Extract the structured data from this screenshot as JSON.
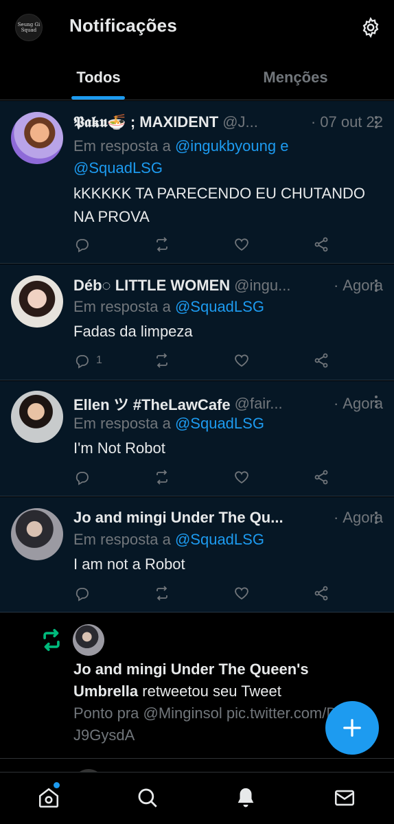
{
  "header": {
    "title": "Notificações",
    "logo_text": "Seung Gi Squad",
    "settings_icon": "gear-icon"
  },
  "tabs": [
    {
      "label": "Todos",
      "active": true
    },
    {
      "label": "Menções",
      "active": false
    }
  ],
  "notifications": [
    {
      "name": "𝕻𝖆𝖐𝖚🍜 ; MAXIDENT",
      "handle": "@J...",
      "time": "07 out 22",
      "reply_prefix": "Em resposta a",
      "reply_mentions": [
        "@ingukbyoung",
        "e",
        "@SquadLSG"
      ],
      "text": "kKKKKK TA PARECENDO EU CHUTANDO NA PROVA",
      "reply_count": ""
    },
    {
      "name": "Déb◌ LITTLE WOMEN",
      "handle": "@ingu...",
      "time": "Agora",
      "reply_prefix": "Em resposta a",
      "reply_mentions": [
        "@SquadLSG"
      ],
      "text": "Fadas da limpeza",
      "reply_count": "1"
    },
    {
      "name": "Ellen ツ #TheLawCafe",
      "handle": "@fair...",
      "time": "Agora",
      "reply_prefix": "Em resposta a",
      "reply_mentions": [
        "@SquadLSG"
      ],
      "text": "I'm Not Robot",
      "reply_count": ""
    },
    {
      "name": "Jo and mingi Under The Qu...",
      "handle": "",
      "time": "Agora",
      "reply_prefix": "Em resposta a",
      "reply_mentions": [
        "@SquadLSG"
      ],
      "text": "I am not a Robot",
      "reply_count": ""
    }
  ],
  "retweet": {
    "user": "Jo and mingi Under The Queen's Umbrella",
    "action": "retweetou seu Tweet",
    "tweet_text": "Ponto pra @Minginsol pic.twitter.com/DQAJ9GysdA"
  },
  "colors": {
    "accent": "#1d9bf0",
    "retweet_green": "#00ba7c",
    "row_bg": "#061725"
  }
}
